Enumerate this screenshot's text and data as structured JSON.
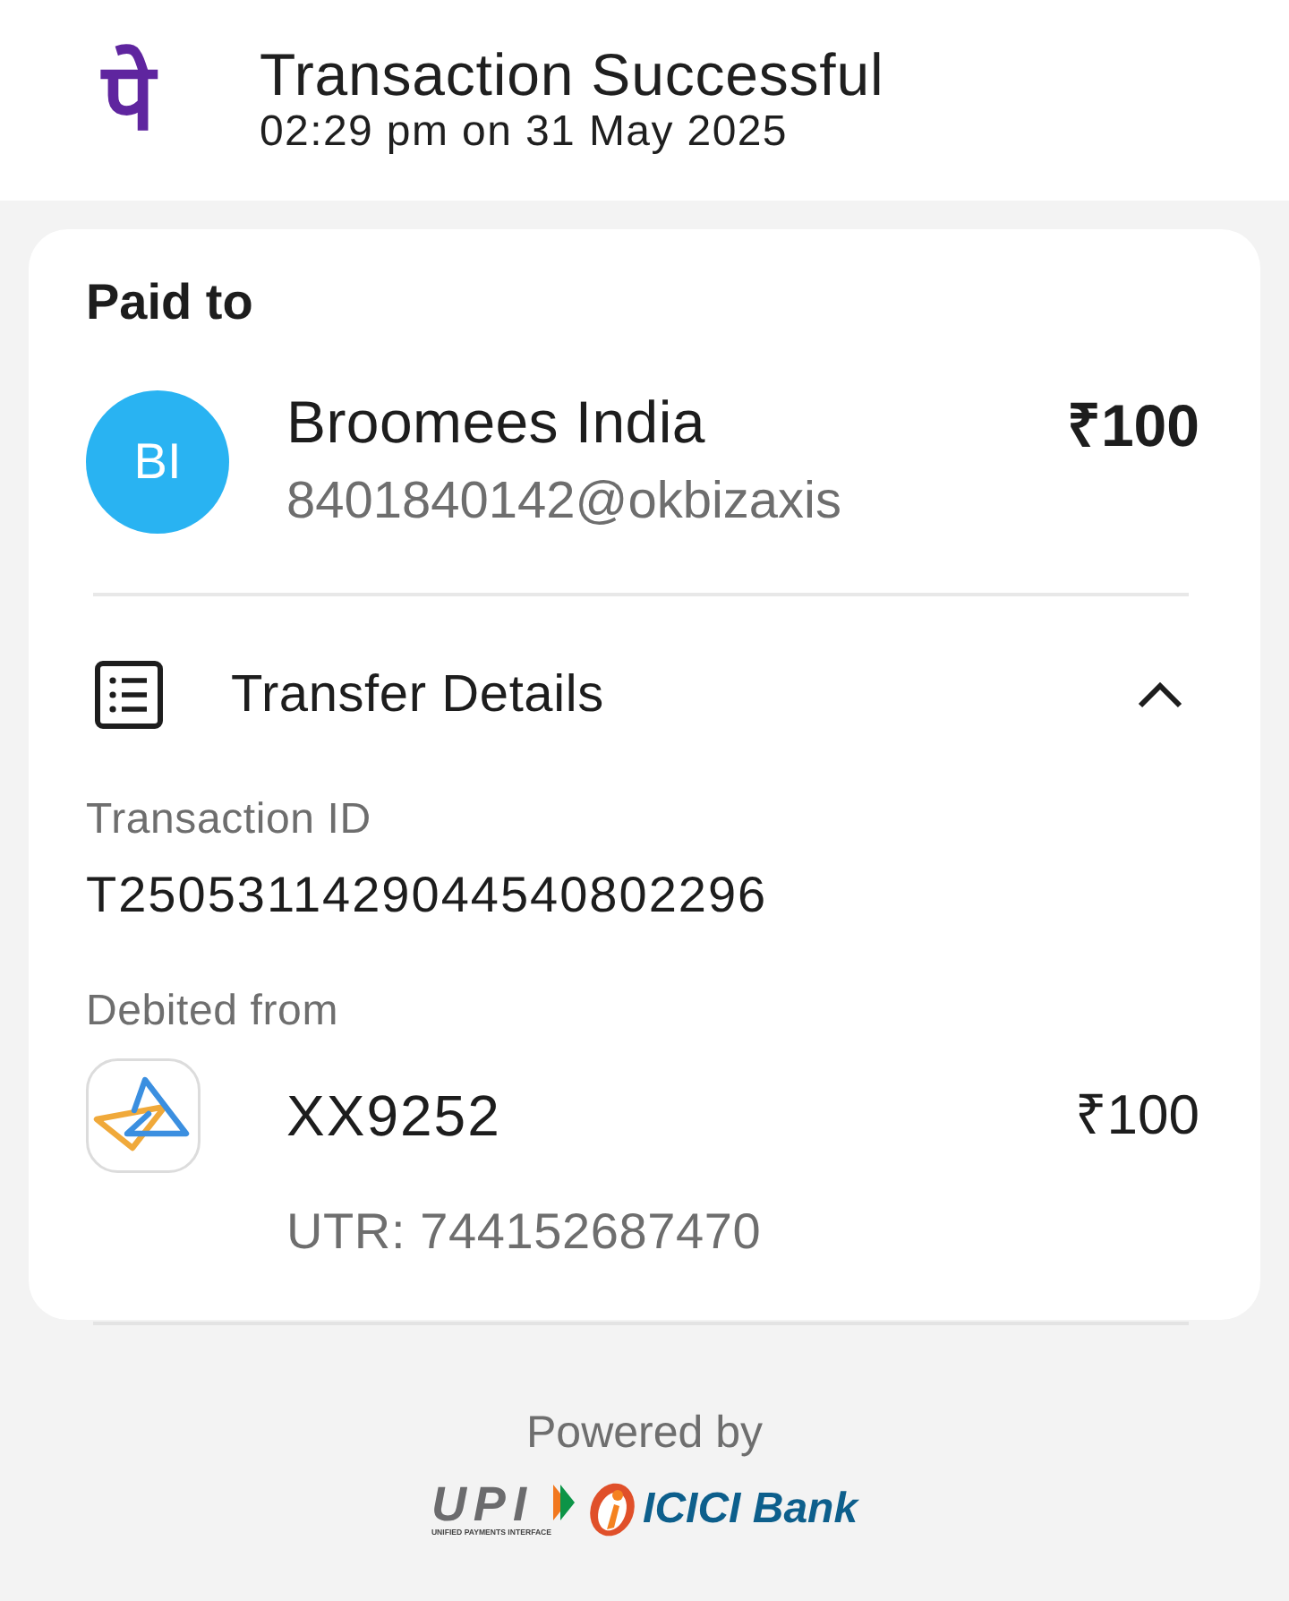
{
  "header": {
    "logo": "पे",
    "title": "Transaction Successful",
    "subtitle": "02:29 pm on 31 May 2025"
  },
  "paid_to": {
    "heading": "Paid to",
    "avatar_initials": "BI",
    "name": "Broomees India",
    "upi_id": "8401840142@okbizaxis",
    "amount": "₹100"
  },
  "transfer_details": {
    "title": "Transfer Details",
    "expanded": true,
    "fields": [
      {
        "label": "Transaction ID",
        "value": "T2505311429044540802296"
      }
    ],
    "debited_from": {
      "label": "Debited from",
      "account": "XX9252",
      "amount": "₹100",
      "utr": "UTR: 744152687470"
    }
  },
  "footer": {
    "powered_by": "Powered by",
    "partners": [
      {
        "kind": "upi",
        "name": "UPI",
        "tagline": "UNIFIED PAYMENTS INTERFACE"
      },
      {
        "kind": "bank",
        "name": "ICICI Bank"
      }
    ]
  }
}
